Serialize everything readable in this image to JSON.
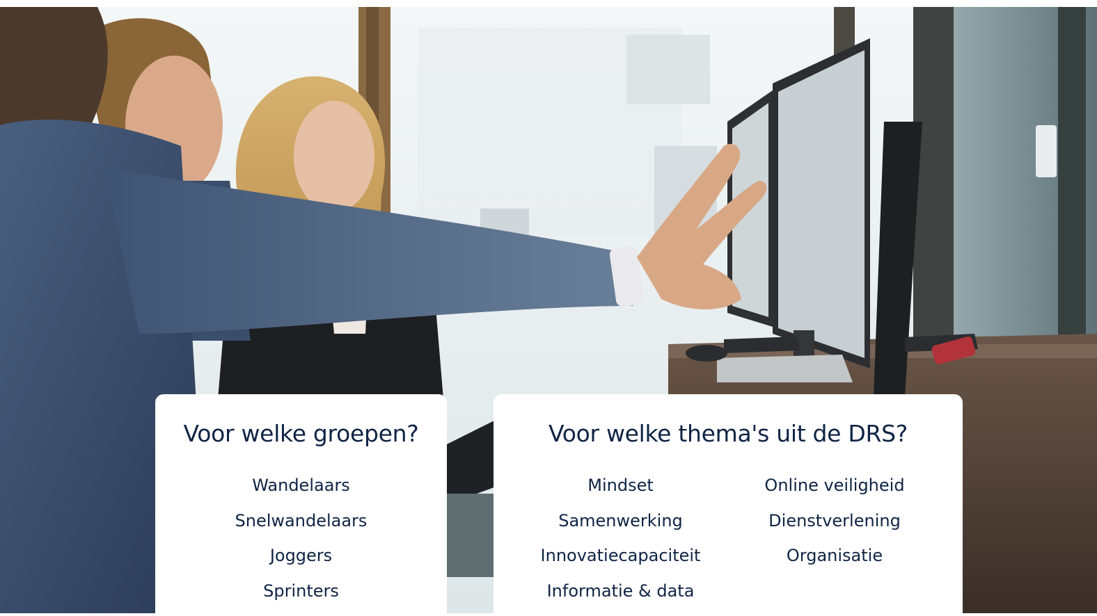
{
  "groups_card": {
    "title": "Voor welke groepen?",
    "items": [
      "Wandelaars",
      "Snelwandelaars",
      "Joggers",
      "Sprinters"
    ]
  },
  "themes_card": {
    "title": "Voor welke thema's uit de DRS?",
    "column_left": [
      "Mindset",
      "Samenwerking",
      "Innovatiecapaciteit",
      "Informatie & data"
    ],
    "column_right": [
      "Online veiligheid",
      "Dienstverlening",
      "Organisatie"
    ]
  },
  "colors": {
    "text": "#0f2444",
    "card_background": "#ffffff"
  }
}
